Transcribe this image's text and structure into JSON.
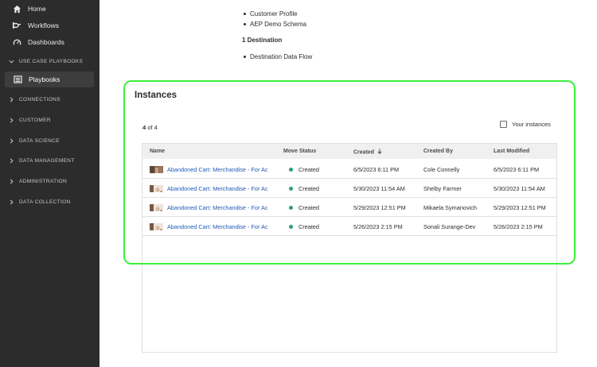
{
  "sidebar": {
    "items": [
      {
        "label": "Home",
        "icon": "home-icon"
      },
      {
        "label": "Workflows",
        "icon": "workflows-icon"
      },
      {
        "label": "Dashboards",
        "icon": "dashboards-icon"
      }
    ],
    "use_case_section": "USE CASE PLAYBOOKS",
    "active_item": "Playbooks",
    "sections": [
      "CONNECTIONS",
      "CUSTOMER",
      "DATA SCIENCE",
      "DATA MANAGEMENT",
      "ADMINISTRATION",
      "DATA COLLECTION"
    ]
  },
  "top": {
    "schemas": [
      "Customer Profile",
      "AEP Demo Schema"
    ],
    "destination_heading": "1 Destination",
    "destinations": [
      "Destination Data Flow"
    ]
  },
  "instances": {
    "title": "Instances",
    "count_current": "4",
    "count_rest": " of 4",
    "your_instances_label": "Your instances",
    "columns": {
      "name": "Name",
      "move_status": "Move Status",
      "created": "Created",
      "created_by": "Created By",
      "last_modified": "Last Modified"
    },
    "rows": [
      {
        "name": "Abandoned Cart: Merchandise - For Ac",
        "status": "Created",
        "created": "6/5/2023 6:11 PM",
        "created_by": "Cole Connelly",
        "last_modified": "6/5/2023 6:11 PM"
      },
      {
        "name": "Abandoned Cart: Merchandise - For Ac",
        "status": "Created",
        "created": "5/30/2023 11:54 AM",
        "created_by": "Shelby Farmer",
        "last_modified": "5/30/2023 11:54 AM"
      },
      {
        "name": "Abandoned Cart: Merchandise - For Ac",
        "status": "Created",
        "created": "5/29/2023 12:51 PM",
        "created_by": "Mikaela Symanovich",
        "last_modified": "5/29/2023 12:51 PM"
      },
      {
        "name": "Abandoned Cart: Merchandise - For Ac",
        "status": "Created",
        "created": "5/26/2023 2:15 PM",
        "created_by": "Sonali Surange-Dev",
        "last_modified": "5/26/2023 2:15 PM"
      }
    ]
  },
  "colors": {
    "sidebar_bg": "#2c2c2c",
    "link": "#1f5bb7",
    "status_created": "#2d9d78",
    "highlight": "#3cf03c"
  }
}
